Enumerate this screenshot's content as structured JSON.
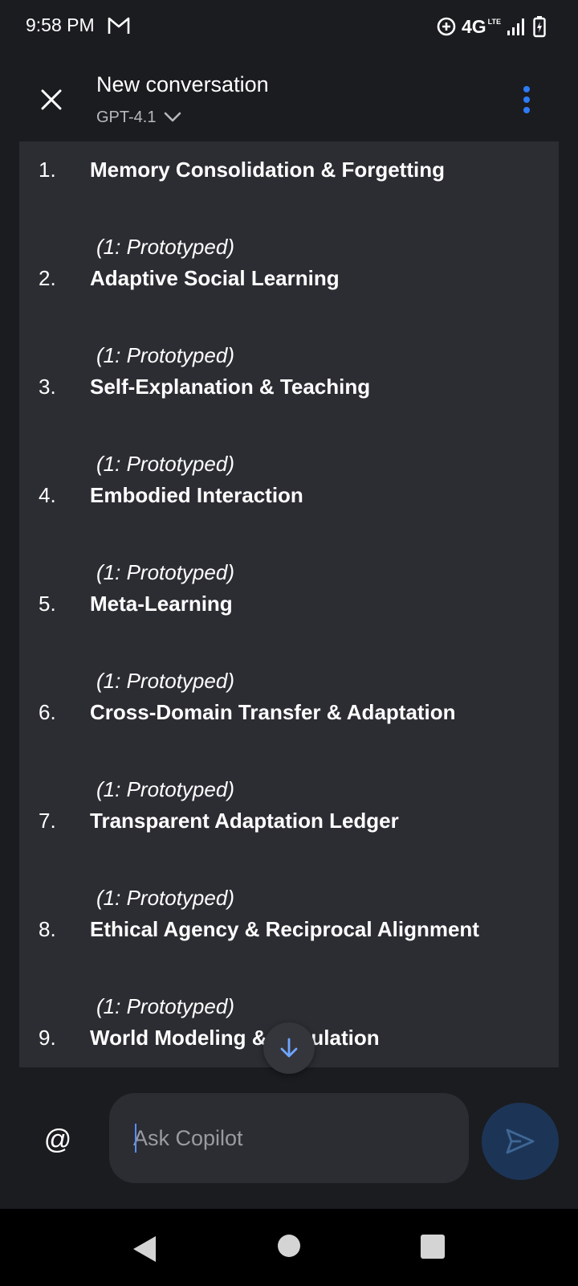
{
  "status_bar": {
    "time": "9:58 PM",
    "network": "4G",
    "network_sub": "LTE",
    "icons": [
      "gmail-icon",
      "data-saver-icon",
      "signal-icon",
      "battery-charging-icon"
    ]
  },
  "header": {
    "title": "New conversation",
    "model": "GPT-4.1",
    "icons": [
      "close-icon",
      "chevron-down-icon",
      "more-vertical-icon"
    ]
  },
  "conversation": {
    "items": [
      {
        "number": "1.",
        "title": "Memory Consolidation & Forgetting",
        "status": "(1: Prototyped)"
      },
      {
        "number": "2.",
        "title": "Adaptive Social Learning",
        "status": "(1: Prototyped)"
      },
      {
        "number": "3.",
        "title": "Self-Explanation & Teaching",
        "status": "(1: Prototyped)"
      },
      {
        "number": "4.",
        "title": "Embodied Interaction",
        "status": "(1: Prototyped)"
      },
      {
        "number": "5.",
        "title": "Meta-Learning",
        "status": "(1: Prototyped)"
      },
      {
        "number": "6.",
        "title": "Cross-Domain Transfer & Adaptation",
        "status": "(1: Prototyped)"
      },
      {
        "number": "7.",
        "title": "Transparent Adaptation Ledger",
        "status": "(1: Prototyped)"
      },
      {
        "number": "8.",
        "title": "Ethical Agency & Reciprocal Alignment",
        "status": "(1: Prototyped)"
      },
      {
        "number": "9.",
        "title": "World Modeling & Simulation",
        "status": ""
      }
    ]
  },
  "input": {
    "mention": "@",
    "placeholder": "Ask Copilot",
    "value": "",
    "icons": [
      "at-sign-icon",
      "send-icon",
      "arrow-down-icon"
    ]
  },
  "colors": {
    "background": "#1b1c20",
    "card": "#2c2d33",
    "accent": "#2f7bf5",
    "send_button": "#1c3557"
  }
}
